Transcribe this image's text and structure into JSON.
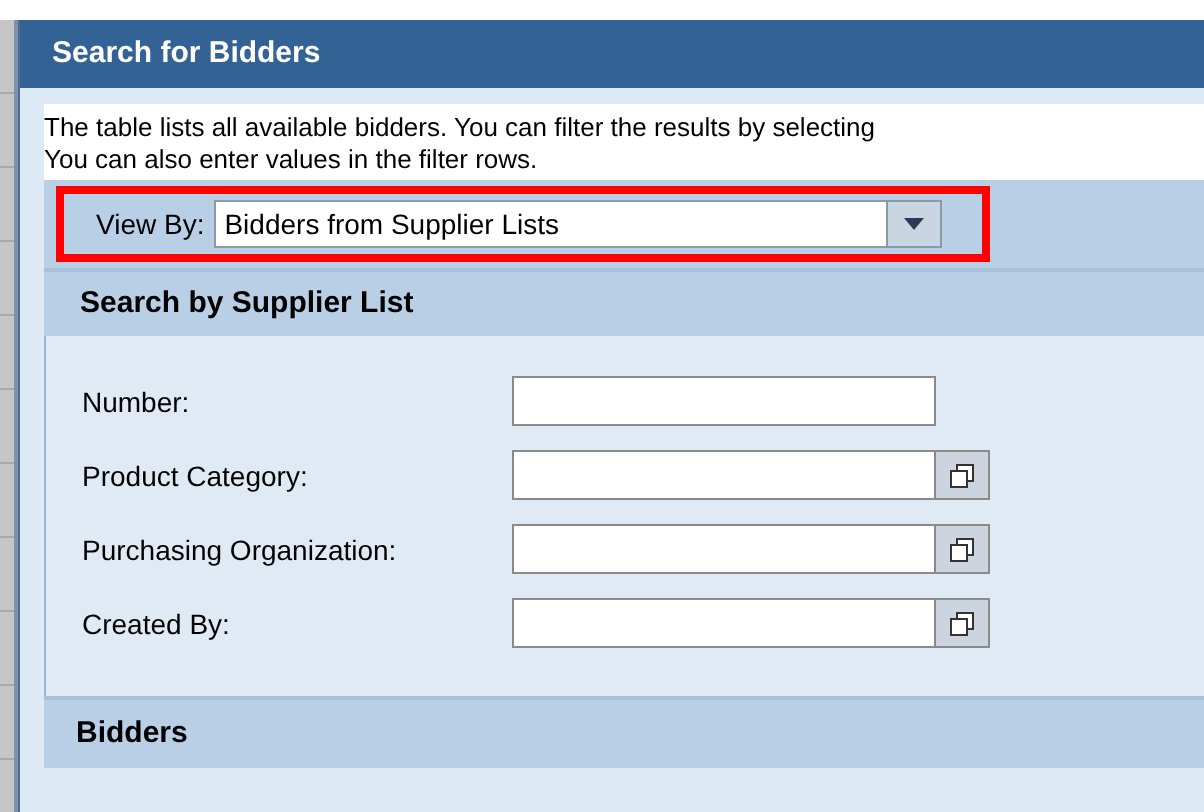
{
  "dialog": {
    "title": "Search for Bidders"
  },
  "intro": {
    "lines": [
      "The table lists all available bidders. You can filter the results by selecting",
      "You can also enter values in the filter rows."
    ]
  },
  "view_by": {
    "label": "View By:",
    "value": "Bidders from Supplier Lists",
    "highlighted": true
  },
  "search_section": {
    "title": "Search by Supplier List",
    "fields": [
      {
        "label": "Number:",
        "kind": "text"
      },
      {
        "label": "Product Category:",
        "kind": "lookup"
      },
      {
        "label": "Purchasing Organization:",
        "kind": "lookup"
      },
      {
        "label": "Created By:",
        "kind": "lookup"
      }
    ]
  },
  "results_section": {
    "title": "Bidders"
  }
}
